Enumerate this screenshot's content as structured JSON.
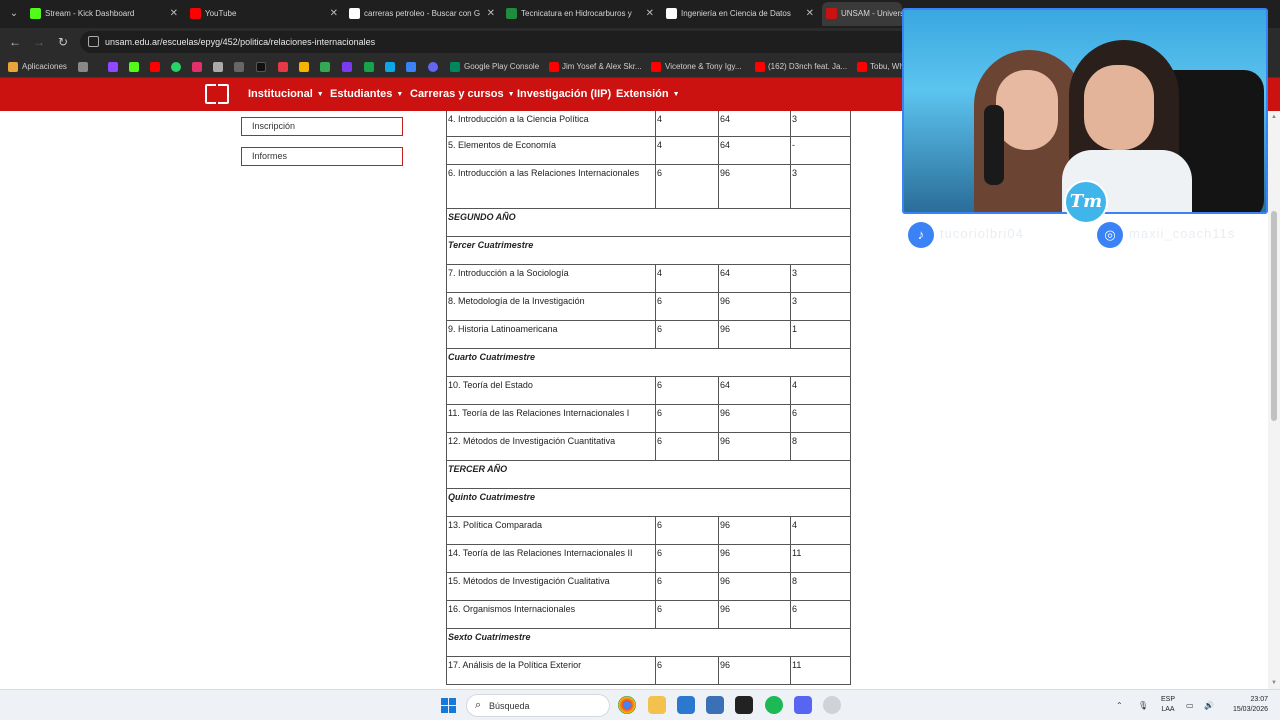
{
  "browser": {
    "tabs": [
      {
        "title": "Stream - Kick Dashboard",
        "icon": "kick-icon",
        "color": "#53fc18"
      },
      {
        "title": "YouTube",
        "icon": "youtube-icon",
        "color": "#ff0000"
      },
      {
        "title": "carreras petroleo - Buscar con G",
        "icon": "google-icon",
        "color": "#ffffff"
      },
      {
        "title": "Tecnicatura en Hidrocarburos y",
        "icon": "doc-icon",
        "color": "#1e8e3e"
      },
      {
        "title": "Ingeniería en Ciencia de Datos",
        "icon": "up-icon",
        "color": "#ffffff"
      },
      {
        "title": "UNSAM - Univers",
        "icon": "unsam-icon",
        "color": "#cc1111"
      }
    ],
    "url": "unsam.edu.ar/escuelas/epyg/452/politica/relaciones-internacionales",
    "bookmarks": [
      "Aplicaciones",
      "Google Play Console",
      "Jim Yosef & Alex Skr...",
      "Vicetone & Tony Igy...",
      "(162) D3nch feat. Ja...",
      "Tobu, Wh"
    ]
  },
  "nav": {
    "items": [
      "Institucional",
      "Estudiantes",
      "Carreras y cursos",
      "Investigación (IIP)",
      "Extensión"
    ]
  },
  "sidebar": {
    "buttons": [
      "Inscripción",
      "Informes"
    ]
  },
  "plan": {
    "rows": [
      {
        "kind": "subject",
        "name": "4. Introducción a la Ciencia Política",
        "a": "4",
        "b": "64",
        "c": "3"
      },
      {
        "kind": "subject",
        "name": "5. Elementos de Economía",
        "a": "4",
        "b": "64",
        "c": "-"
      },
      {
        "kind": "subject-tall",
        "name": "6. Introducción a las Relaciones Internacionales",
        "a": "6",
        "b": "96",
        "c": "3"
      },
      {
        "kind": "section",
        "name": "SEGUNDO AÑO"
      },
      {
        "kind": "section",
        "name": "Tercer Cuatrimestre"
      },
      {
        "kind": "subject",
        "name": "7. Introducción a la Sociología",
        "a": "4",
        "b": "64",
        "c": "3"
      },
      {
        "kind": "subject",
        "name": "8. Metodología de la Investigación",
        "a": "6",
        "b": "96",
        "c": "3"
      },
      {
        "kind": "subject",
        "name": "9. Historia Latinoamericana",
        "a": "6",
        "b": "96",
        "c": "1"
      },
      {
        "kind": "section",
        "name": "Cuarto Cuatrimestre"
      },
      {
        "kind": "subject",
        "name": "10. Teoría del Estado",
        "a": "6",
        "b": "64",
        "c": "4"
      },
      {
        "kind": "subject",
        "name": "11. Teoría de las Relaciones Internacionales I",
        "a": "6",
        "b": "96",
        "c": "6"
      },
      {
        "kind": "subject",
        "name": "12. Métodos de Investigación Cuantitativa",
        "a": "6",
        "b": "96",
        "c": "8"
      },
      {
        "kind": "section",
        "name": "TERCER AÑO"
      },
      {
        "kind": "section",
        "name": "Quinto Cuatrimestre"
      },
      {
        "kind": "subject",
        "name": "13. Política Comparada",
        "a": "6",
        "b": "96",
        "c": "4"
      },
      {
        "kind": "subject",
        "name": "14. Teoría de las Relaciones Internacionales II",
        "a": "6",
        "b": "96",
        "c": "11"
      },
      {
        "kind": "subject",
        "name": "15. Métodos de Investigación Cualitativa",
        "a": "6",
        "b": "96",
        "c": "8"
      },
      {
        "kind": "subject",
        "name": "16. Organismos Internacionales",
        "a": "6",
        "b": "96",
        "c": "6"
      },
      {
        "kind": "section",
        "name": "Sexto Cuatrimestre"
      },
      {
        "kind": "subject",
        "name": "17. Análisis de la Política Exterior",
        "a": "6",
        "b": "96",
        "c": "11"
      }
    ]
  },
  "overlay": {
    "logo": "Tm",
    "tiktok_handle": "tucoriolbri04",
    "instagram_handle": "maxii_coach11s"
  },
  "taskbar": {
    "search": "Búsqueda",
    "lang_top": "ESP",
    "lang_bottom": "LAA",
    "time": "23:07",
    "date": "15/03/2026"
  },
  "colors": {
    "brand_red": "#cc1111",
    "overlay_blue": "#3b82f6"
  }
}
